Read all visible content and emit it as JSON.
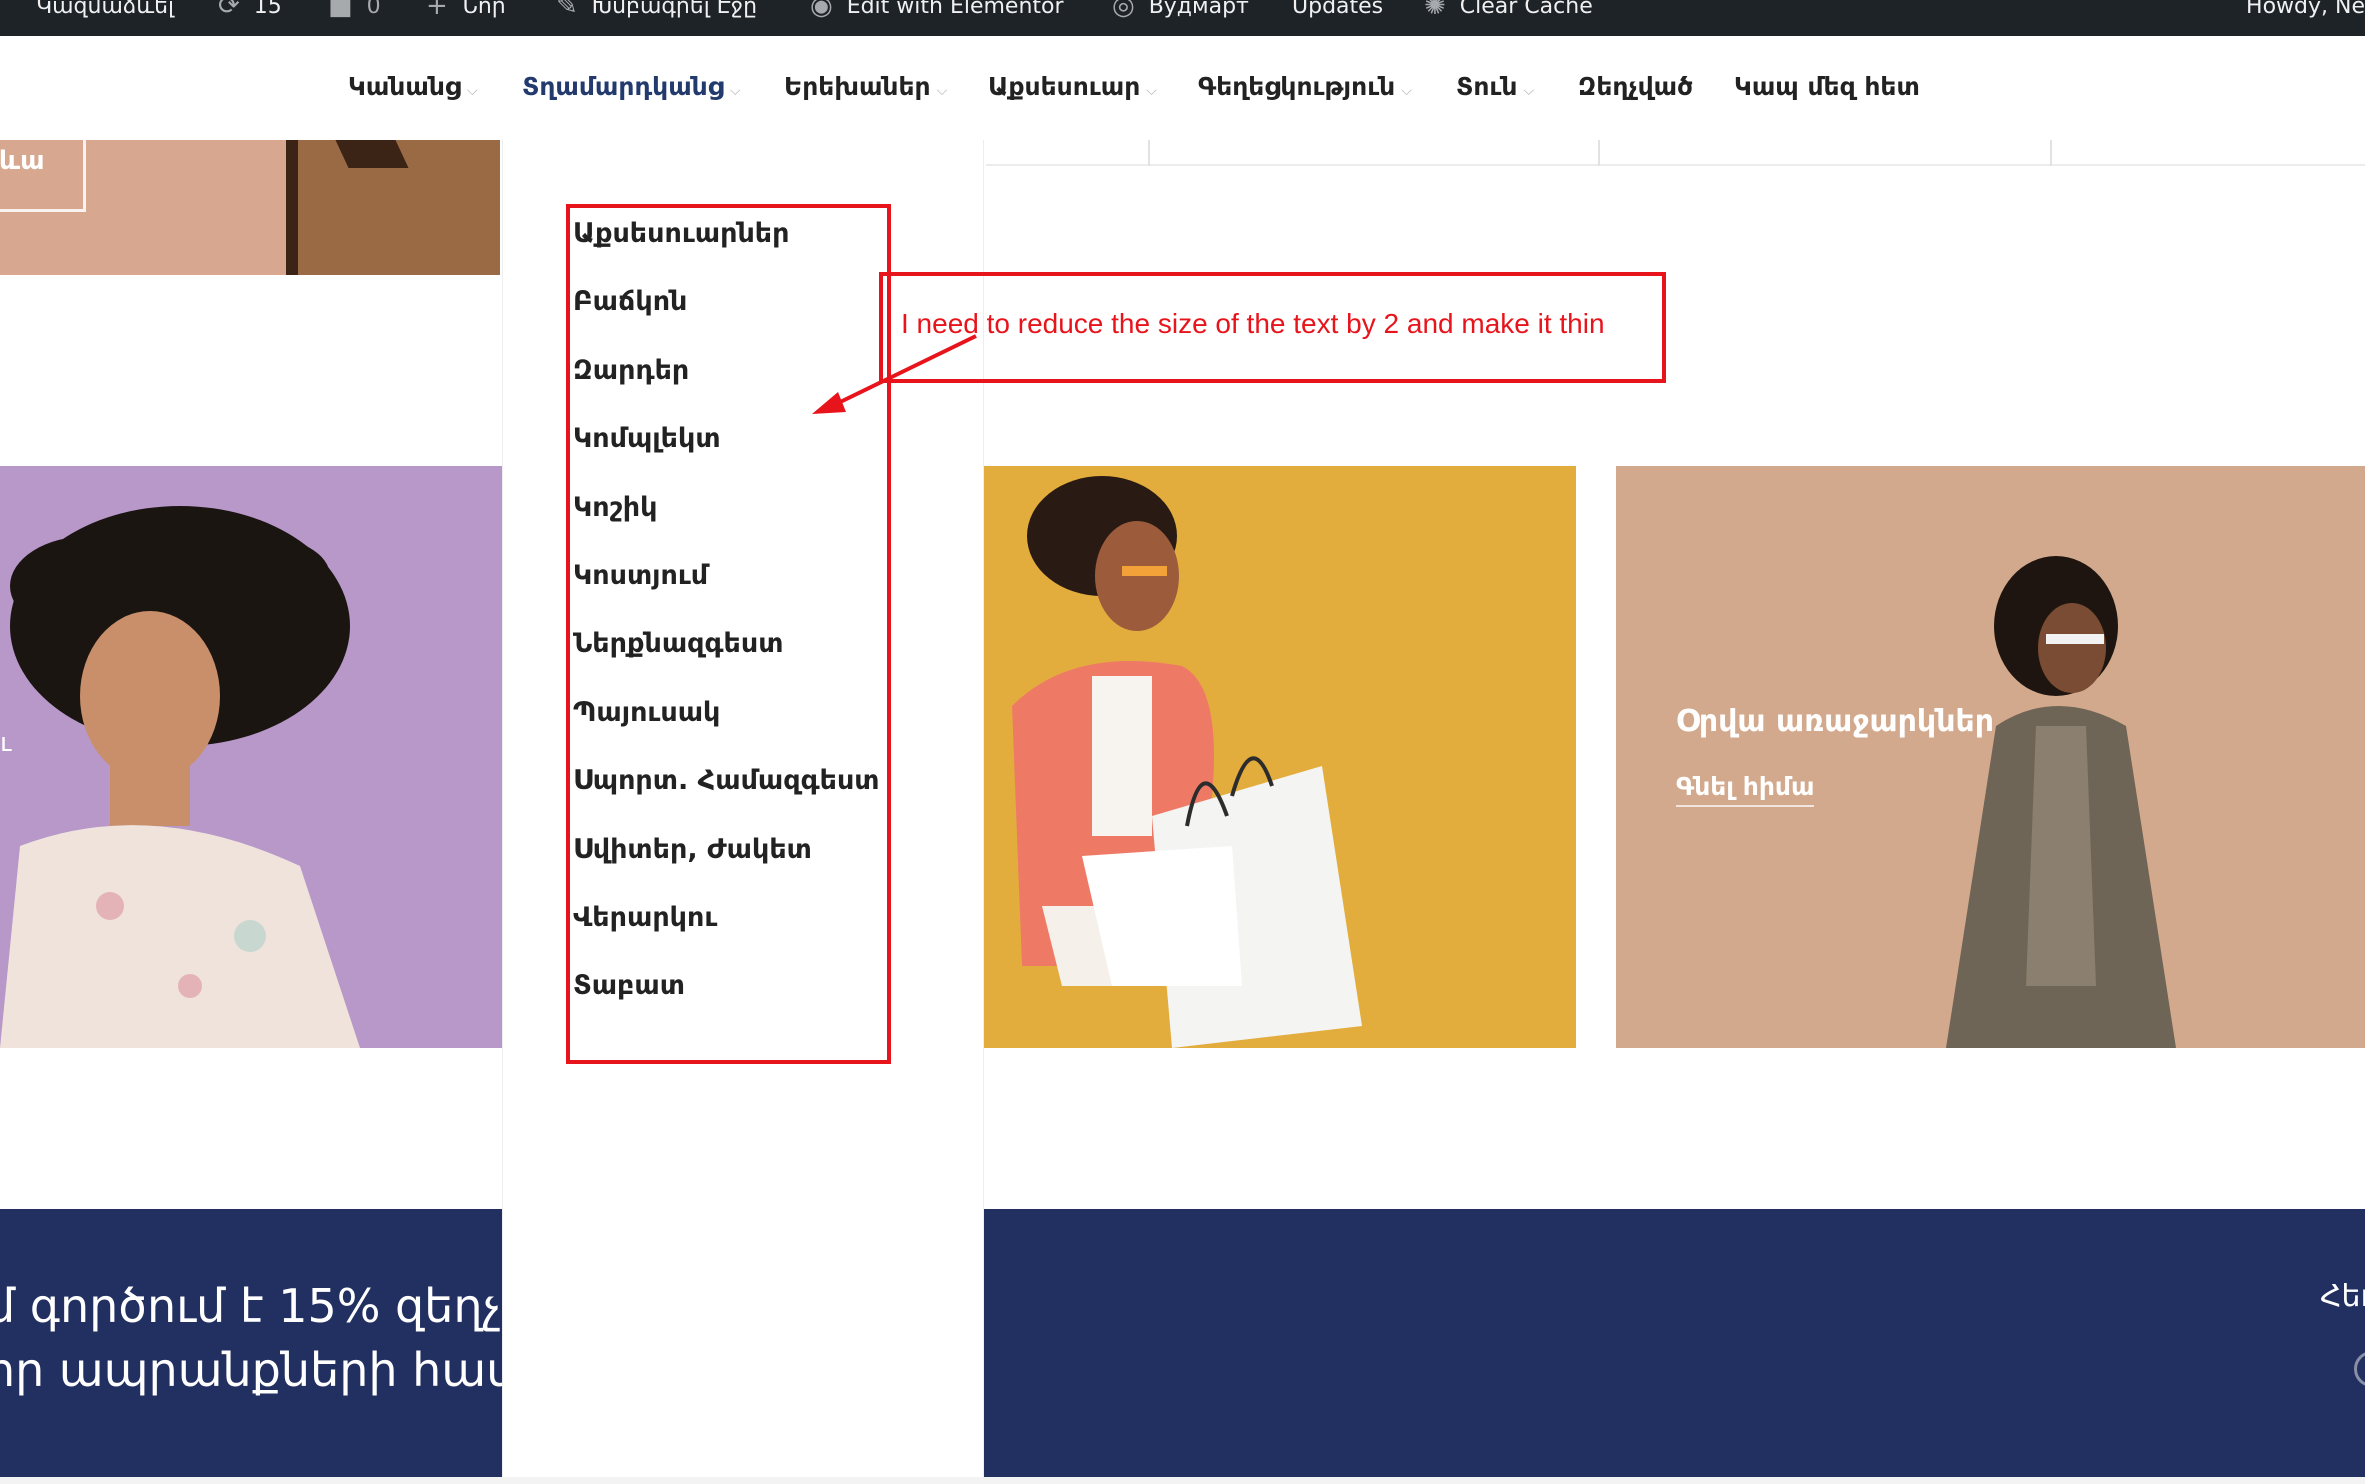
{
  "admin_bar": {
    "customize": "Կազմաձևել",
    "updates_count": "15",
    "comments_count": "0",
    "new": "Նոր",
    "edit_page": "Խմբագրել Էջը",
    "edit_elementor": "Edit with Elementor",
    "site": "Вудмарт",
    "updates": "Updates",
    "clear_cache": "Clear Cache",
    "howdy": "Howdy, Ne"
  },
  "nav": {
    "items": [
      {
        "label": "Կանանց",
        "has_caret": true
      },
      {
        "label": "Տղամարդկանց",
        "has_caret": true,
        "active": true
      },
      {
        "label": "Երեխաներ",
        "has_caret": true
      },
      {
        "label": "Աքսեսուար",
        "has_caret": true
      },
      {
        "label": "Գեղեցկություն",
        "has_caret": true
      },
      {
        "label": "Տուն",
        "has_caret": true
      },
      {
        "label": "Զեղչված",
        "has_caret": false
      },
      {
        "label": "Կապ մեզ հետ",
        "has_caret": false
      }
    ],
    "caret": "⌵"
  },
  "dropdown": {
    "items": [
      "Աքսեսուարներ",
      "Բաճկոն",
      "Զարդեր",
      "Կոմպլեկտ",
      "Կոշիկ",
      "Կոստյում",
      "Ներքնազգեստ",
      "Պայուսակ",
      "Սպորտ. Համազգեստ",
      "Սվիտեր, Ժակետ",
      "Վերարկու",
      "Տաբատ"
    ]
  },
  "hero": {
    "left_button_partial": "ևա"
  },
  "cards": {
    "c1_partial": "ւ",
    "c3_title": "Օրվա առաջարկներ",
    "c3_link": "Գնել հիմա"
  },
  "promo": {
    "line1": "մ գործում է 15% զեղչ",
    "line2": "որ ապրանքների համա",
    "right_partial": "Հեւ"
  },
  "annotation": {
    "text": "I need to reduce the size of the text by 2 and make it thin",
    "color": "#e8141c"
  },
  "colors": {
    "admin_bar": "#1d2327",
    "nav_active": "#233a6e",
    "promo_bg": "#213060"
  }
}
